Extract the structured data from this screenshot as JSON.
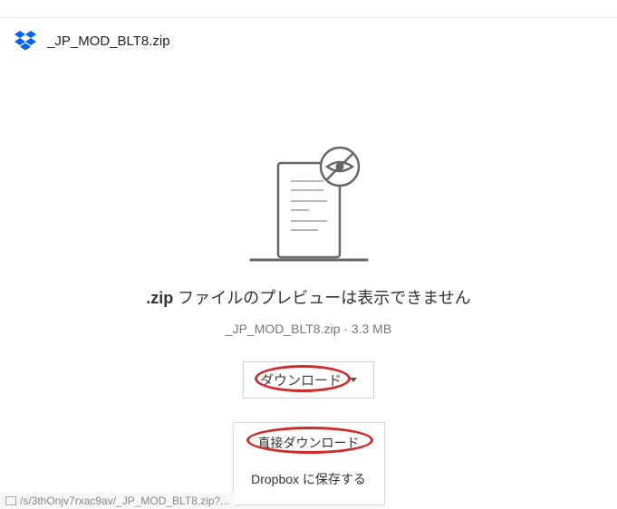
{
  "header": {
    "filename": "_JP_MOD_BLT8.zip"
  },
  "preview": {
    "extension": ".zip",
    "message_suffix": " ファイルのプレビューは表示できません",
    "filename": "_JP_MOD_BLT8.zip",
    "separator": " · ",
    "filesize": "3.3 MB"
  },
  "download": {
    "button_label": "ダウンロード",
    "menu": {
      "direct": "直接ダウンロード",
      "save_to_dropbox": "Dropbox に保存する"
    }
  },
  "statusbar": {
    "url_fragment": "/s/3thOnjv7rxac9av/_JP_MOD_BLT8.zip?..."
  },
  "icons": {
    "dropbox": "dropbox-logo",
    "no_preview": "no-preview-eye",
    "caret": "caret-down"
  },
  "colors": {
    "brand": "#0061ff",
    "annotation": "#d12a2a",
    "text_muted": "#777777"
  }
}
